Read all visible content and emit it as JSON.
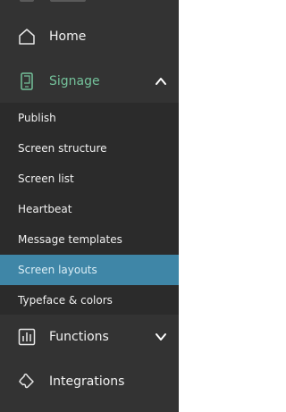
{
  "colors": {
    "sidebar_bg": "#333333",
    "submenu_bg": "#2b2b2b",
    "active_text": "#74c29b",
    "selected_bg": "#3f86a7"
  },
  "nav": {
    "home": {
      "label": "Home",
      "icon": "home-icon"
    },
    "signage": {
      "label": "Signage",
      "icon": "tablet-icon",
      "expanded": true
    },
    "functions": {
      "label": "Functions",
      "icon": "bar-chart-icon",
      "expanded": false
    },
    "integrations": {
      "label": "Integrations",
      "icon": "puzzle-icon"
    }
  },
  "submenu": {
    "items": [
      {
        "label": "Publish"
      },
      {
        "label": "Screen structure"
      },
      {
        "label": "Screen list"
      },
      {
        "label": "Heartbeat"
      },
      {
        "label": "Message templates"
      },
      {
        "label": "Screen layouts",
        "selected": true
      },
      {
        "label": "Typeface & colors"
      }
    ]
  }
}
